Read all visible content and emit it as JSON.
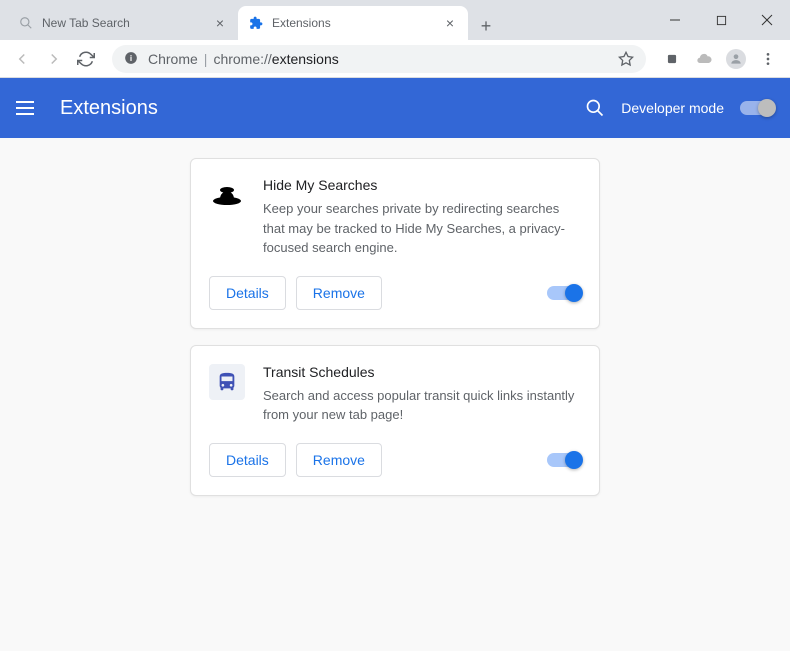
{
  "tabs": [
    {
      "title": "New Tab Search",
      "active": false,
      "favicon": "search"
    },
    {
      "title": "Extensions",
      "active": true,
      "favicon": "puzzle"
    }
  ],
  "omnibox": {
    "chrome_label": "Chrome",
    "path_prefix": "chrome://",
    "path_bold": "extensions"
  },
  "appheader": {
    "title": "Extensions",
    "devmode_label": "Developer mode"
  },
  "extensions": [
    {
      "name": "Hide My Searches",
      "description": "Keep your searches private by redirecting searches that may be tracked to Hide My Searches, a privacy-focused search engine.",
      "details_label": "Details",
      "remove_label": "Remove",
      "enabled": true,
      "icon": "hat"
    },
    {
      "name": "Transit Schedules",
      "description": "Search and access popular transit quick links instantly from your new tab page!",
      "details_label": "Details",
      "remove_label": "Remove",
      "enabled": true,
      "icon": "bus"
    }
  ]
}
